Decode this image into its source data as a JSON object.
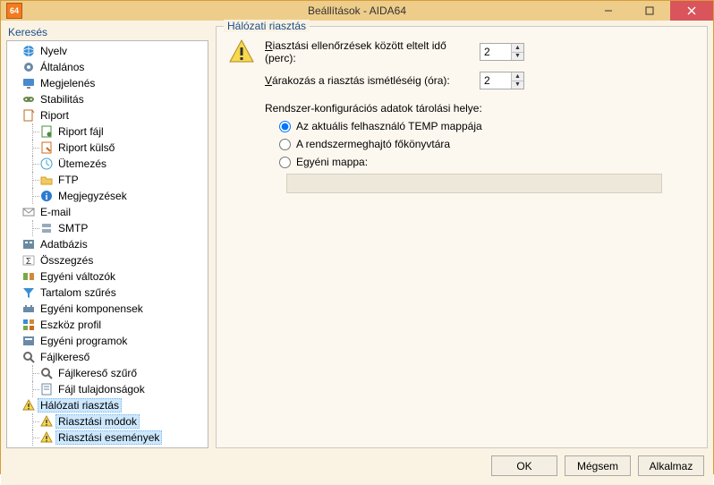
{
  "window": {
    "title": "Beállítások - AIDA64",
    "app_icon_text": "64"
  },
  "left": {
    "search_label": "Keresés",
    "tree": {
      "nyelv": "Nyelv",
      "altalanos": "Általános",
      "megjelenes": "Megjelenés",
      "stabilitas": "Stabilitás",
      "riport": "Riport",
      "riport_fajl": "Riport fájl",
      "riport_kulso": "Riport külső",
      "utemezes": "Ütemezés",
      "ftp": "FTP",
      "megjegyzesek": "Megjegyzések",
      "email": "E-mail",
      "smtp": "SMTP",
      "adatbazis": "Adatbázis",
      "osszegzes": "Összegzés",
      "egyeni_valtozok": "Egyéni változók",
      "tartalom_szures": "Tartalom szűrés",
      "egyeni_komponensek": "Egyéni komponensek",
      "eszkoz_profil": "Eszköz profil",
      "egyeni_programok": "Egyéni programok",
      "fajlkereso": "Fájlkereső",
      "fajlkereso_szuro": "Fájlkereső szűrő",
      "fajl_tulajdonsagok": "Fájl tulajdonságok",
      "halozati_riasztas": "Hálózati riasztás",
      "riasztasi_modok": "Riasztási módok",
      "riasztasi_esemenyek": "Riasztási események"
    }
  },
  "right": {
    "group_title": "Hálózati riasztás",
    "check_interval_label": "Riasztási ellenőrzések között eltelt idő (perc):",
    "check_interval_value": "2",
    "wait_repeat_label": "Várakozás a riasztás ismétléséig (óra):",
    "wait_repeat_value": "2",
    "storage_label": "Rendszer-konfigurációs adatok tárolási helye:",
    "radio_user_temp": "Az aktuális felhasználó TEMP mappája",
    "radio_sysdrive_root": "A rendszermeghajtó főkönyvtára",
    "radio_custom": "Egyéni mappa:",
    "selected_radio": "user_temp",
    "custom_path": ""
  },
  "buttons": {
    "ok": "OK",
    "cancel": "Mégsem",
    "apply": "Alkalmaz"
  }
}
